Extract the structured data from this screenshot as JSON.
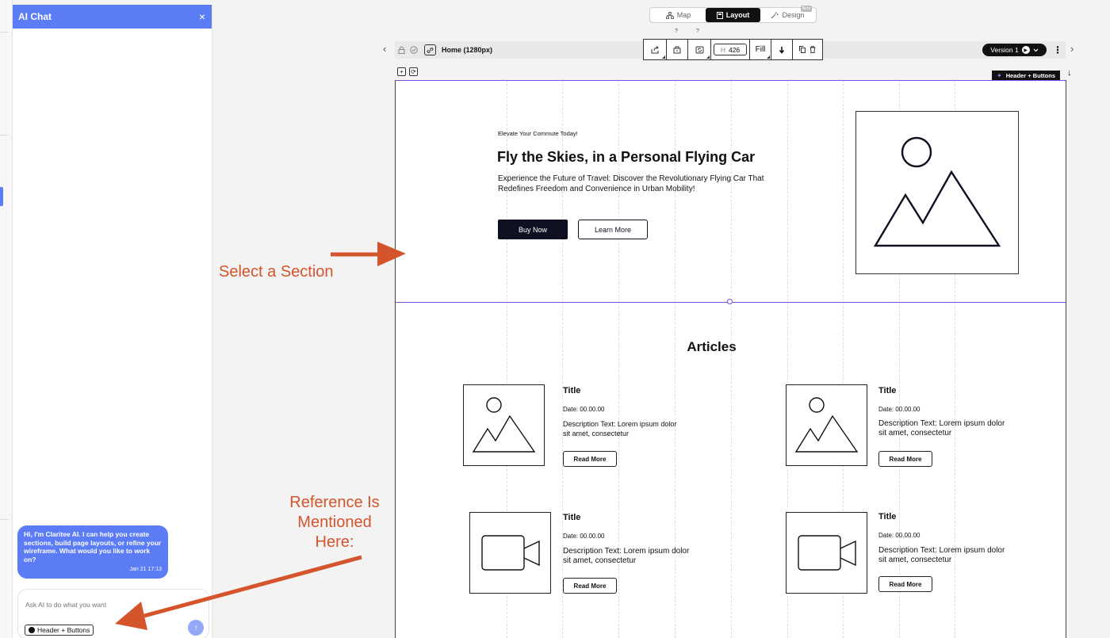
{
  "chat": {
    "title": "AI Chat",
    "close_icon": "×",
    "welcome_message": "Hi, I'm Claritee AI. I can help you create sections, build page layouts, or refine your wireframe. What would you like to work on?",
    "welcome_time": "Jan 21 17:13",
    "input_placeholder": "Ask AI to do what you want",
    "reference_chip": "Header + Buttons",
    "send_icon": "↑"
  },
  "mode_switch": {
    "tabs": [
      {
        "label": "Map",
        "icon": "sitemap-icon"
      },
      {
        "label": "Layout",
        "icon": "layout-icon",
        "active": true
      },
      {
        "label": "Design",
        "icon": "magic-icon"
      }
    ],
    "beta_label": "Beta",
    "help_marks": [
      "?",
      "?"
    ]
  },
  "toolbar": {
    "prev_arrow": "‹",
    "next_arrow": "›",
    "page_name": "Home (1280px)",
    "height_label": "H",
    "height_value": "426",
    "width_mode": "Fill",
    "version_label": "Version 1",
    "more_icon": "⋮"
  },
  "selection": {
    "label": "Header + Buttons"
  },
  "hero": {
    "eyebrow": "Elevate Your Commute Today!",
    "title": "Fly the Skies, in a Personal Flying Car",
    "description": "Experience the Future of Travel: Discover the Revolutionary Flying Car That Redefines Freedom and Convenience in Urban Mobility!",
    "primary_button": "Buy Now",
    "secondary_button": "Learn More"
  },
  "articles": {
    "title": "Articles",
    "cards": [
      {
        "title": "Title",
        "date": "Date: 00.00.00",
        "description": "Description Text: Lorem ipsum dolor sit amet, consectetur",
        "button": "Read More",
        "media": "image"
      },
      {
        "title": "Title",
        "date": "Date: 00.00.00",
        "description": "Description Text: Lorem ipsum dolor sit amet, consectetur",
        "button": "Read More",
        "media": "image"
      },
      {
        "title": "Title",
        "date": "Date: 00.00.00",
        "description": "Description Text: Lorem ipsum dolor sit amet, consectetur",
        "button": "Read More",
        "media": "video"
      },
      {
        "title": "Title",
        "date": "Date: 00.00.00",
        "description": "Description Text: Lorem ipsum dolor sit amet, consectetur",
        "button": "Read More",
        "media": "video"
      }
    ]
  },
  "annotations": {
    "select_section": "Select a Section",
    "reference_note_lines": [
      "Reference Is",
      "Mentioned",
      "Here:"
    ],
    "color": "#d4542c"
  },
  "colors": {
    "accent": "#5b7cf5",
    "selection": "#7c4ddb",
    "dark_button": "#0f1123"
  }
}
